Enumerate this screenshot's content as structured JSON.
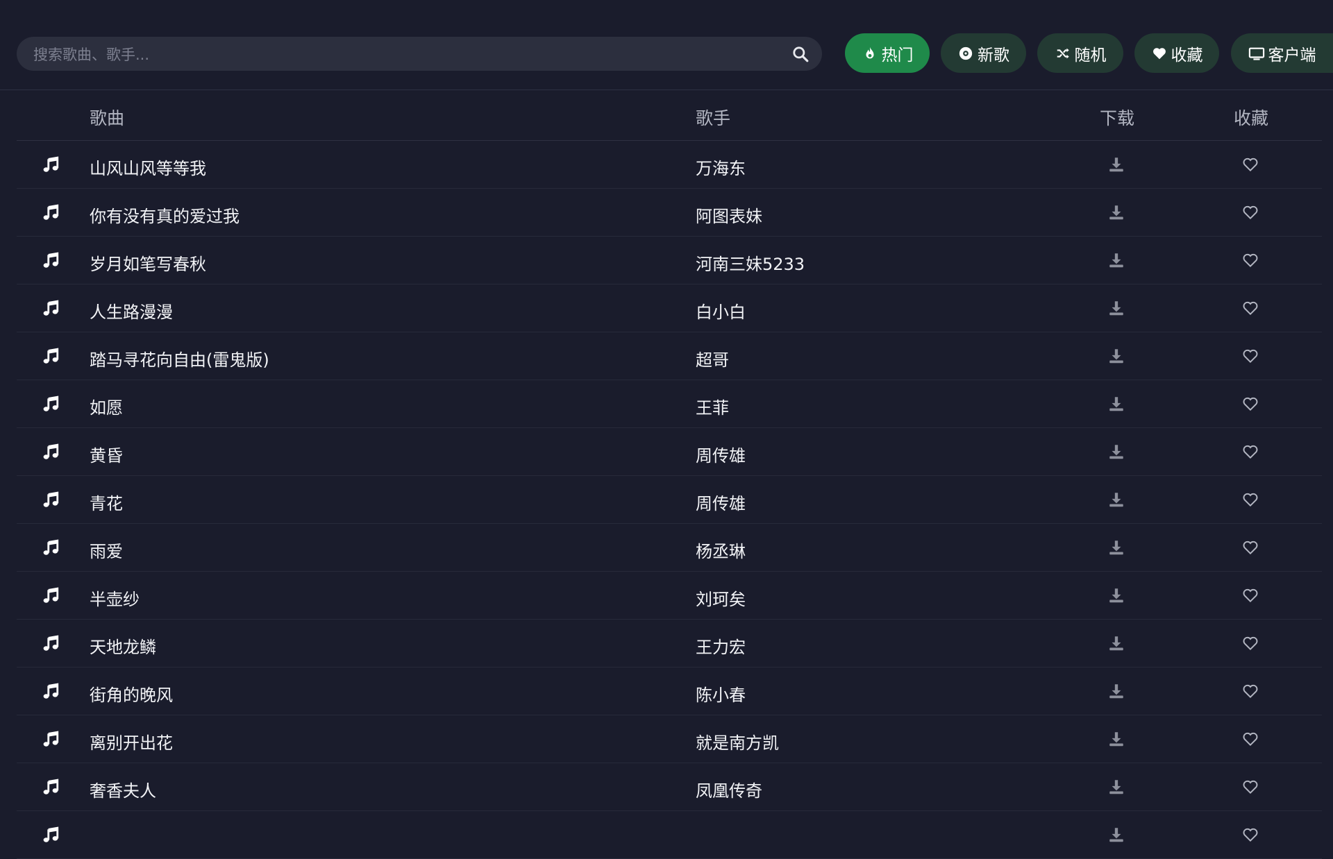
{
  "search": {
    "placeholder": "搜索歌曲、歌手...",
    "value": ""
  },
  "nav": [
    {
      "label": "热门",
      "icon": "fire-icon",
      "active": true
    },
    {
      "label": "新歌",
      "icon": "disc-icon",
      "active": false
    },
    {
      "label": "随机",
      "icon": "shuffle-icon",
      "active": false
    },
    {
      "label": "收藏",
      "icon": "heart-icon",
      "active": false
    },
    {
      "label": "客户端",
      "icon": "monitor-icon",
      "active": false
    }
  ],
  "columns": {
    "song": "歌曲",
    "artist": "歌手",
    "download": "下载",
    "favorite": "收藏"
  },
  "songs": [
    {
      "title": "山风山风等等我",
      "artist": "万海东"
    },
    {
      "title": "你有没有真的爱过我",
      "artist": "阿图表妹"
    },
    {
      "title": "岁月如笔写春秋",
      "artist": "河南三妹5233"
    },
    {
      "title": "人生路漫漫",
      "artist": "白小白"
    },
    {
      "title": "踏马寻花向自由(雷鬼版)",
      "artist": "超哥"
    },
    {
      "title": "如愿",
      "artist": "王菲"
    },
    {
      "title": "黄昏",
      "artist": "周传雄"
    },
    {
      "title": "青花",
      "artist": "周传雄"
    },
    {
      "title": "雨爱",
      "artist": "杨丞琳"
    },
    {
      "title": "半壶纱",
      "artist": "刘珂矣"
    },
    {
      "title": "天地龙鳞",
      "artist": "王力宏"
    },
    {
      "title": "街角的晚风",
      "artist": "陈小春"
    },
    {
      "title": "离别开出花",
      "artist": "就是南方凯"
    },
    {
      "title": "奢香夫人",
      "artist": "凤凰传奇"
    },
    {
      "title": "",
      "artist": ""
    }
  ],
  "colors": {
    "background": "#1a1c2c",
    "accent": "#1f8a4a",
    "button": "#233a33"
  }
}
